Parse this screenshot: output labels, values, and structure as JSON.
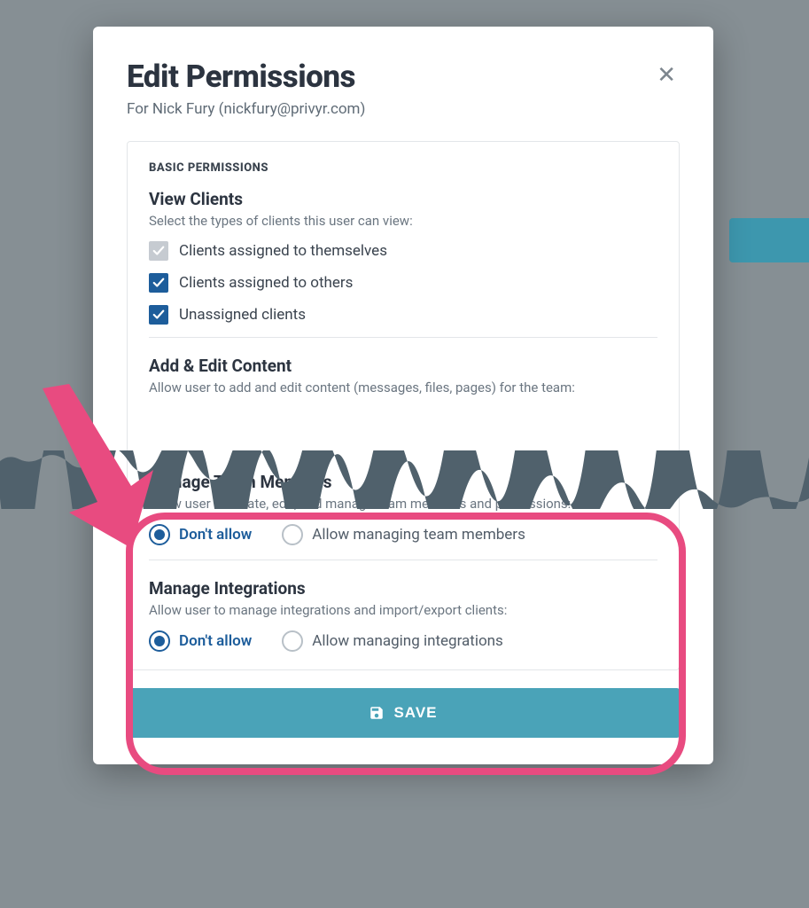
{
  "modal": {
    "title": "Edit Permissions",
    "subtitle": "For Nick Fury (nickfury@privyr.com)"
  },
  "sections": {
    "basic_label": "BASIC PERMISSIONS",
    "view_clients": {
      "title": "View Clients",
      "desc": "Select the types of clients this user can view:",
      "options": {
        "self": "Clients assigned to themselves",
        "others": "Clients assigned to others",
        "unassigned": "Unassigned clients"
      }
    },
    "add_edit": {
      "title": "Add & Edit Content",
      "desc": "Allow user to add and edit content (messages, files, pages) for the team:"
    },
    "manage_team": {
      "title": "Manage Team Members",
      "desc": "Allow user to create, edit, and manage team members and permissions:",
      "dont_allow": "Don't allow",
      "allow": "Allow managing team members"
    },
    "manage_integrations": {
      "title": "Manage Integrations",
      "desc": "Allow user to manage integrations and import/export clients:",
      "dont_allow": "Don't allow",
      "allow": "Allow managing integrations"
    }
  },
  "buttons": {
    "save": "SAVE"
  }
}
